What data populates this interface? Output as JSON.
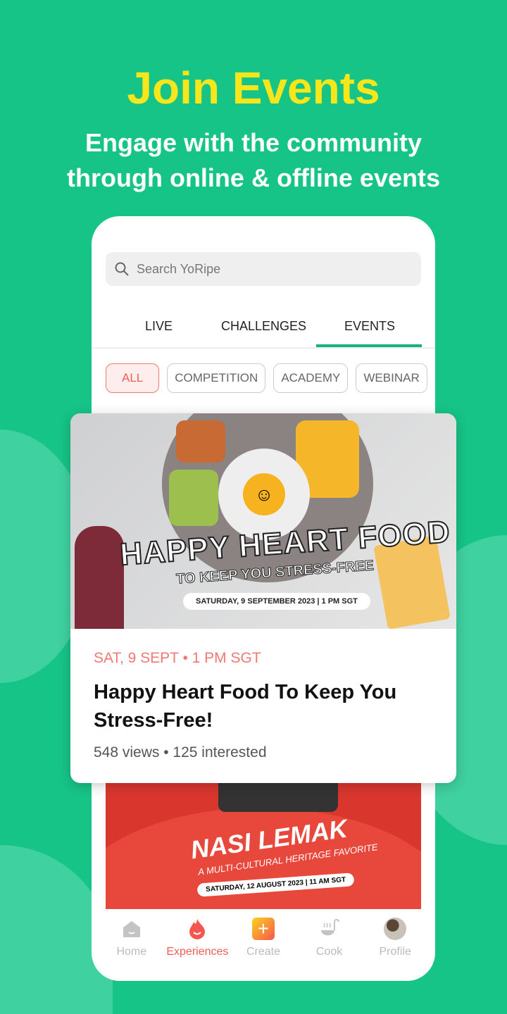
{
  "promo": {
    "title": "Join Events",
    "subtitle_line1": "Engage with the community",
    "subtitle_line2": "through online & offline events"
  },
  "search": {
    "placeholder": "Search YoRipe"
  },
  "tabs": [
    {
      "label": "LIVE"
    },
    {
      "label": "CHALLENGES"
    },
    {
      "label": "EVENTS",
      "active": true
    }
  ],
  "filters": [
    {
      "label": "ALL",
      "active": true
    },
    {
      "label": "COMPETITION"
    },
    {
      "label": "ACADEMY"
    },
    {
      "label": "WEBINAR"
    }
  ],
  "featured_event": {
    "poster": {
      "headline": "HAPPY HEART FOOD",
      "tagline": "TO KEEP YOU STRESS-FREE",
      "date": "SATURDAY, 9 SEPTEMBER 2023 | 1 PM SGT"
    },
    "date": "SAT, 9 SEPT • 1 PM SGT",
    "title": "Happy Heart Food To Keep You Stress-Free!",
    "stats": "548 views • 125 interested"
  },
  "next_event": {
    "poster": {
      "headline": "NASI LEMAK",
      "tagline": "A MULTI-CULTURAL HERITAGE FAVORITE",
      "date": "SATURDAY, 12 AUGUST 2023 | 11 AM SGT"
    }
  },
  "bottom_nav": [
    {
      "label": "Home",
      "icon": "home-icon"
    },
    {
      "label": "Experiences",
      "icon": "flame-icon",
      "active": true
    },
    {
      "label": "Create",
      "icon": "plus-icon"
    },
    {
      "label": "Cook",
      "icon": "ladle-icon"
    },
    {
      "label": "Profile",
      "icon": "avatar"
    }
  ],
  "colors": {
    "background": "#17c488",
    "title": "#f7e619",
    "accent": "#ef5d55",
    "tab_underline": "#17b37f"
  }
}
